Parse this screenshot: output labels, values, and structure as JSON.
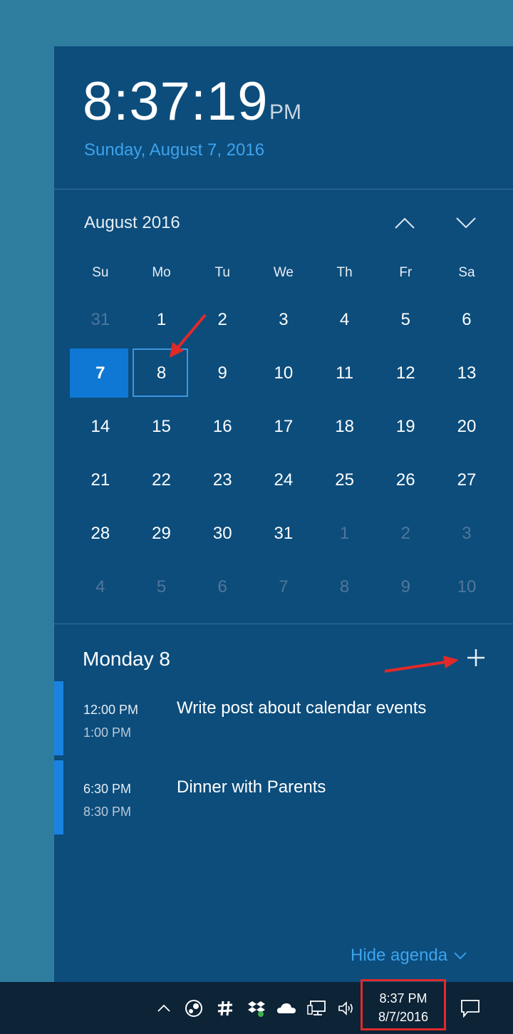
{
  "clock": {
    "time": "8:37:19",
    "ampm": "PM",
    "date_long": "Sunday, August 7, 2016"
  },
  "calendar": {
    "month_title": "August 2016",
    "days_of_week": [
      "Su",
      "Mo",
      "Tu",
      "We",
      "Th",
      "Fr",
      "Sa"
    ],
    "weeks": [
      [
        {
          "d": "31",
          "other": true
        },
        {
          "d": "1"
        },
        {
          "d": "2"
        },
        {
          "d": "3"
        },
        {
          "d": "4"
        },
        {
          "d": "5"
        },
        {
          "d": "6"
        }
      ],
      [
        {
          "d": "7",
          "today": true
        },
        {
          "d": "8",
          "selected": true
        },
        {
          "d": "9"
        },
        {
          "d": "10"
        },
        {
          "d": "11"
        },
        {
          "d": "12"
        },
        {
          "d": "13"
        }
      ],
      [
        {
          "d": "14"
        },
        {
          "d": "15"
        },
        {
          "d": "16"
        },
        {
          "d": "17"
        },
        {
          "d": "18"
        },
        {
          "d": "19"
        },
        {
          "d": "20"
        }
      ],
      [
        {
          "d": "21"
        },
        {
          "d": "22"
        },
        {
          "d": "23"
        },
        {
          "d": "24"
        },
        {
          "d": "25"
        },
        {
          "d": "26"
        },
        {
          "d": "27"
        }
      ],
      [
        {
          "d": "28"
        },
        {
          "d": "29"
        },
        {
          "d": "30"
        },
        {
          "d": "31"
        },
        {
          "d": "1",
          "other": true
        },
        {
          "d": "2",
          "other": true
        },
        {
          "d": "3",
          "other": true
        }
      ],
      [
        {
          "d": "4",
          "other": true
        },
        {
          "d": "5",
          "other": true
        },
        {
          "d": "6",
          "other": true
        },
        {
          "d": "7",
          "other": true
        },
        {
          "d": "8",
          "other": true
        },
        {
          "d": "9",
          "other": true
        },
        {
          "d": "10",
          "other": true
        }
      ]
    ]
  },
  "agenda": {
    "title": "Monday 8",
    "events": [
      {
        "start": "12:00 PM",
        "end": "1:00 PM",
        "title": "Write post about calendar events"
      },
      {
        "start": "6:30 PM",
        "end": "8:30 PM",
        "title": "Dinner with Parents"
      }
    ],
    "hide_label": "Hide agenda"
  },
  "taskbar": {
    "time": "8:37 PM",
    "date": "8/7/2016",
    "tray_icons": [
      "chevron-up-icon",
      "steam-icon",
      "slack-icon",
      "dropbox-icon",
      "onedrive-icon",
      "network-icon",
      "volume-icon",
      "action-center-icon"
    ]
  },
  "colors": {
    "flyout_bg": "#0c4d7c",
    "accent": "#0f78d4",
    "date_link": "#3ea3ec",
    "annotation": "#e02a2a"
  }
}
